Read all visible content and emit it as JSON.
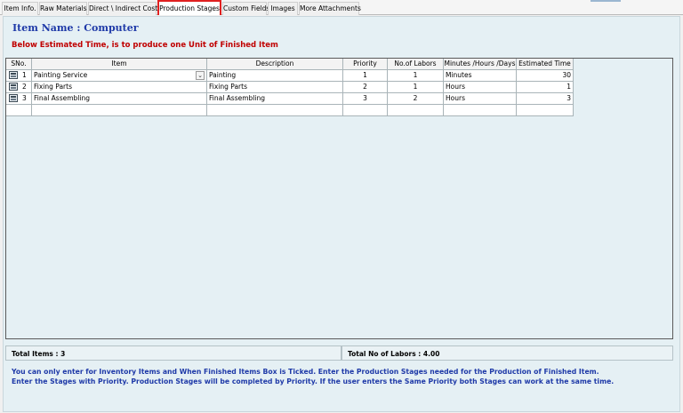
{
  "tabs": [
    {
      "label": "Item Info.",
      "active": false
    },
    {
      "label": "Raw Materials",
      "active": false
    },
    {
      "label": "Direct \\ Indirect Cost",
      "active": false
    },
    {
      "label": "Production Stages",
      "active": true
    },
    {
      "label": "Custom Fields",
      "active": false
    },
    {
      "label": "Images",
      "active": false
    },
    {
      "label": "More Attachments",
      "active": false
    }
  ],
  "header": {
    "item_name": "Item Name : Computer",
    "estimate_note": "Below Estimated Time, is to produce one Unit of Finished Item"
  },
  "grid": {
    "columns": [
      "SNo.",
      "Item",
      "Description",
      "Priority",
      "No.of Labors",
      "Minutes /Hours /Days",
      "Estimated Time"
    ],
    "rows": [
      {
        "sno": "1",
        "item": "Painting Service",
        "description": "Painting",
        "priority": "1",
        "labors": "1",
        "unit": "Minutes",
        "estimated": "30"
      },
      {
        "sno": "2",
        "item": "Fixing Parts",
        "description": "Fixing Parts",
        "priority": "2",
        "labors": "1",
        "unit": "Hours",
        "estimated": "1"
      },
      {
        "sno": "3",
        "item": "Final Assembling",
        "description": "Final Assembling",
        "priority": "3",
        "labors": "2",
        "unit": "Hours",
        "estimated": "3"
      }
    ]
  },
  "footer": {
    "total_items": "Total Items : 3",
    "total_labors": "Total No of Labors : 4.00"
  },
  "help": {
    "line1": "You can only enter for Inventory Items and When Finished Items Box is Ticked. Enter the Production Stages needed for the Production of Finished Item.",
    "line2": "Enter the Stages with Priority. Production Stages will be completed by Priority. If the user enters the Same Priority both Stages can work at the same time."
  },
  "colors": {
    "tab_highlight": "#e02020",
    "item_name": "#1f3aa8",
    "estimate_note": "#c00000",
    "panel_bg": "#e5f0f4"
  },
  "icons": {
    "row_selector": "grid-row-icon",
    "item_dropdown": "chevron-down-icon"
  }
}
